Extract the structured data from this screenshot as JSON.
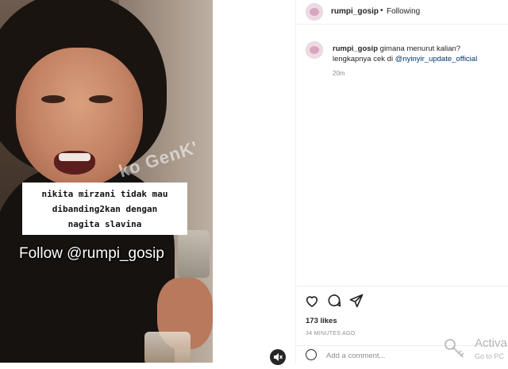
{
  "video": {
    "caption_lines": [
      "nikita mirzani tidak mau",
      "dibanding2kan dengan",
      "nagita slavina"
    ],
    "follow_text": "Follow @rumpi_gosip",
    "watermark": "ko GenK'"
  },
  "header": {
    "username": "rumpi_gosip",
    "separator": "•",
    "follow_status": "Following"
  },
  "comment": {
    "username": "rumpi_gosip",
    "text_part1": " gimana menurut kalian?",
    "text_part2": "lengkapnya cek di ",
    "mention": "@nyinyir_update_official",
    "time": "20m"
  },
  "actions": {
    "icons": [
      "heart-icon",
      "comment-icon",
      "share-icon"
    ],
    "likes": "173 likes",
    "posted_ago": "34 MINUTES AGO",
    "add_comment_placeholder": "Add a comment..."
  },
  "overlay": {
    "activate_text": "Activa",
    "activate_sub": "Go to PC"
  }
}
